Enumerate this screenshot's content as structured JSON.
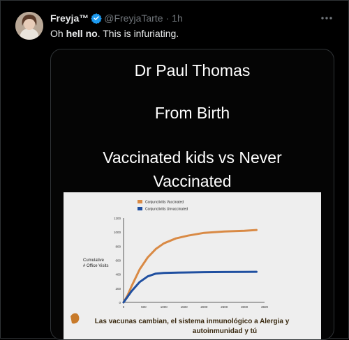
{
  "tweet": {
    "author_name": "Freyja™",
    "handle": "@FreyjaTarte",
    "separator": "·",
    "time": "1h",
    "text_prefix": "Oh ",
    "text_bold": "hell no",
    "text_suffix": ". This is infuriating."
  },
  "media": {
    "line1": "Dr Paul Thomas",
    "line2": "From Birth",
    "line3": "Vaccinated kids vs Never",
    "line4": "Vaccinated",
    "subtitle_line1": "Las vacunas cambian, el sistema inmunológico a Alergia y",
    "subtitle_line2": "autoinmunidad y tú"
  },
  "chart_data": {
    "type": "line",
    "ylabel": "Cumulative # Office Visits",
    "ylim": [
      0,
      1200
    ],
    "xlim": [
      0,
      3500
    ],
    "y_ticks": [
      "1200",
      "1000",
      "800",
      "600",
      "400",
      "200",
      "0"
    ],
    "x_ticks": [
      "0",
      "500",
      "1000",
      "1500",
      "2000",
      "2500",
      "3000",
      "3500"
    ],
    "series": [
      {
        "name": "Conjunctivitis Vaccinated",
        "color": "#d98a45",
        "x": [
          0,
          100,
          200,
          400,
          600,
          800,
          1000,
          1300,
          1600,
          2000,
          2500,
          3000,
          3300
        ],
        "y": [
          0,
          100,
          230,
          470,
          640,
          760,
          840,
          910,
          950,
          990,
          1010,
          1020,
          1030
        ]
      },
      {
        "name": "Conjunctivitis Unvaccinated",
        "color": "#1f4fa0",
        "x": [
          0,
          100,
          200,
          400,
          600,
          800,
          1000,
          1500,
          2000,
          2500,
          3000,
          3300
        ],
        "y": [
          0,
          80,
          160,
          290,
          370,
          410,
          420,
          425,
          430,
          432,
          433,
          435
        ]
      }
    ]
  },
  "colors": {
    "verified": "#1d9bf0",
    "muted": "#71767b",
    "text": "#e7e9ea"
  }
}
